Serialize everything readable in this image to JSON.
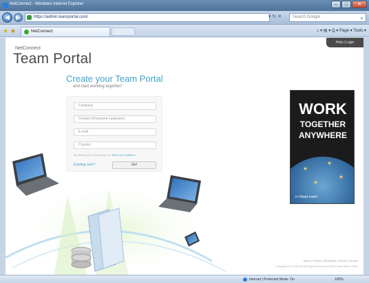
{
  "window": {
    "title": "NetConnect - Windows Internet Explorer"
  },
  "toolbar": {
    "url": "https://admin.teamportal.com/",
    "search_placeholder": "Search Google",
    "tab_title": "NetConnect",
    "commands": "Page ▾  Tools ▾"
  },
  "site": {
    "userbar": "Help | Login",
    "brand_sub": "NetConnect",
    "brand": "Team Portal",
    "headline": "Create your Team Portal",
    "subline": "and start working together!"
  },
  "form": {
    "company": "Company",
    "contact": "Contact (Firstname Lastname)",
    "email": "E-mail",
    "country": "Country",
    "terms_prefix": "By clicking Go! you accept our",
    "terms_link": "Terms & Conditions",
    "existing": "Existing user?",
    "go": "Go!"
  },
  "ad": {
    "line1": "WORK",
    "line2": "TOGETHER",
    "line3": "ANYWHERE",
    "readmore": ">> Read more!"
  },
  "footer": {
    "links": "About | Partner | Developer | Terms | Contact",
    "copy": "Copyright (C) 2008-09 All Rights Reserved NetConnect World Wide"
  },
  "status": {
    "zone": "Internet | Protected Mode: On",
    "zoom": "100%"
  },
  "colors": {
    "accent": "#3fa3c8",
    "ad_bg": "#1b1b1b"
  }
}
